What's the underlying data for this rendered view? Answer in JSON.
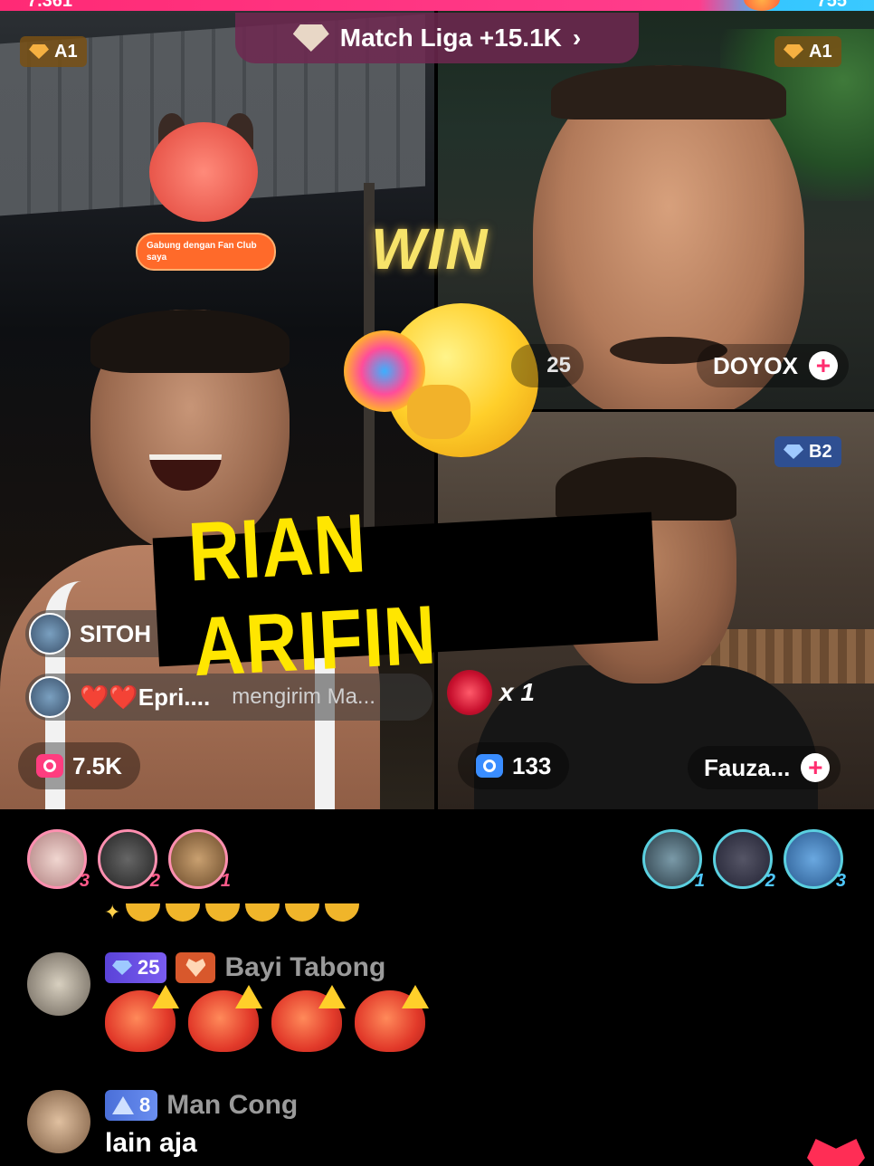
{
  "top_bar": {
    "score_left": "7.361",
    "score_right": "755"
  },
  "match_liga": {
    "label": "Match Liga +15.1K",
    "icon": "diamond-icon",
    "chevron": "›"
  },
  "rank_badges": {
    "left": "A1",
    "top_right": "A1",
    "bottom_right": "B2"
  },
  "fan_club": {
    "label": "Gabung dengan Fan Club saya"
  },
  "win_text": "WIN",
  "hosts": {
    "top_right": {
      "name": "DOYOX",
      "score_partial": "25"
    },
    "bottom_right": {
      "name": "Fauza...",
      "viewers": "133"
    },
    "left": {
      "viewers": "7.5K"
    }
  },
  "gift_events": [
    {
      "user": "SITOH",
      "message": ""
    },
    {
      "user": "❤️❤️Epri....",
      "message": "mengirim Ma..."
    }
  ],
  "rose_gift": {
    "count": "x 1"
  },
  "title_overlay": "RIAN ARIFIN",
  "rank_left": [
    "3",
    "2",
    "1"
  ],
  "rank_right": [
    "1",
    "2",
    "3"
  ],
  "chat": [
    {
      "level": "25",
      "username": "Bayi Tabong",
      "message": ""
    },
    {
      "level": "8",
      "username": "Man Cong",
      "message": "lain aja"
    }
  ],
  "colors": {
    "accent_pink": "#ff2d6f",
    "title_yellow": "#ffe600",
    "win_gold": "#f7e36a"
  }
}
